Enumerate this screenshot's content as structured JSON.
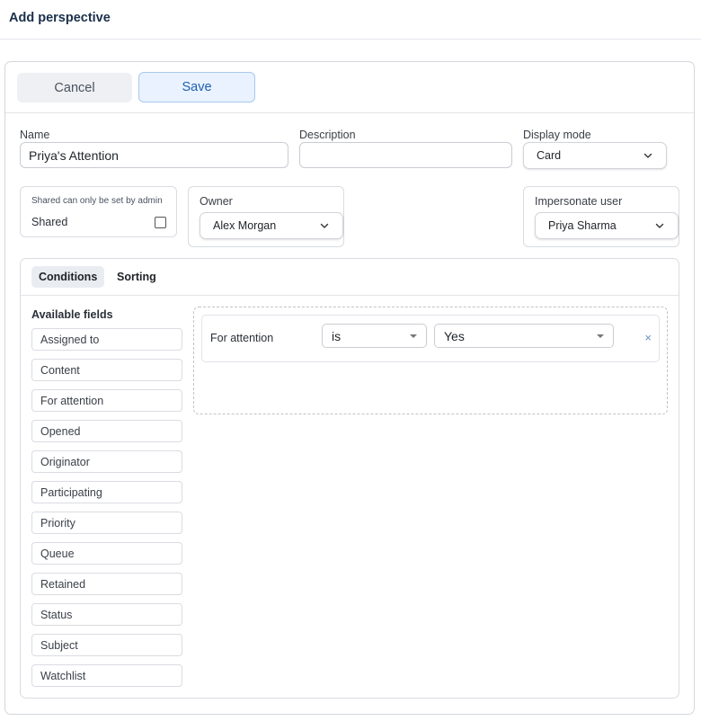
{
  "page": {
    "title": "Add perspective"
  },
  "toolbar": {
    "cancel_label": "Cancel",
    "save_label": "Save"
  },
  "form": {
    "name": {
      "label": "Name",
      "value": "Priya's Attention"
    },
    "description": {
      "label": "Description",
      "value": ""
    },
    "display_mode": {
      "label": "Display mode",
      "value": "Card"
    },
    "shared": {
      "note": "Shared can only be set by admin",
      "label": "Shared",
      "checked": false
    },
    "owner": {
      "label": "Owner",
      "value": "Alex Morgan"
    },
    "impersonate": {
      "label": "Impersonate user",
      "value": "Priya Sharma"
    }
  },
  "tabs": [
    {
      "label": "Conditions",
      "active": true
    },
    {
      "label": "Sorting",
      "active": false
    }
  ],
  "available_fields": {
    "title": "Available fields",
    "items": [
      "Assigned to",
      "Content",
      "For attention",
      "Opened",
      "Originator",
      "Participating",
      "Priority",
      "Queue",
      "Retained",
      "Status",
      "Subject",
      "Watchlist"
    ]
  },
  "condition": {
    "field": "For attention",
    "operator": "is",
    "value": "Yes",
    "remove_glyph": "×"
  },
  "colors": {
    "accent": "#1f5fb0",
    "title": "#1b2f4b",
    "remove": "#6b8fc2"
  }
}
